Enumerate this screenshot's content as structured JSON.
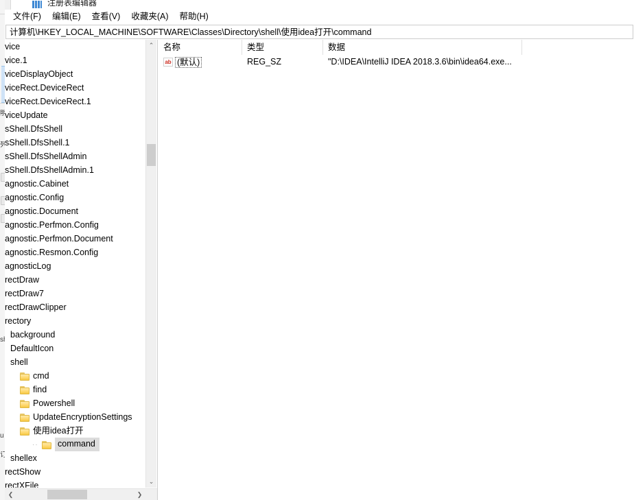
{
  "window": {
    "title": "注册表编辑器",
    "icon": "registry-editor-icon"
  },
  "menu": {
    "items": [
      {
        "label": "文件(F)"
      },
      {
        "label": "编辑(E)"
      },
      {
        "label": "查看(V)"
      },
      {
        "label": "收藏夹(A)"
      },
      {
        "label": "帮助(H)"
      }
    ]
  },
  "address": {
    "path": "计算机\\HKEY_LOCAL_MACHINE\\SOFTWARE\\Classes\\Directory\\shell\\使用idea打开\\command"
  },
  "tree": {
    "items": [
      {
        "label": "vice",
        "indent": 0,
        "icon": "none",
        "selected": false
      },
      {
        "label": "vice.1",
        "indent": 0,
        "icon": "none",
        "selected": false
      },
      {
        "label": "viceDisplayObject",
        "indent": 0,
        "icon": "none",
        "selected": false
      },
      {
        "label": "viceRect.DeviceRect",
        "indent": 0,
        "icon": "none",
        "selected": false
      },
      {
        "label": "viceRect.DeviceRect.1",
        "indent": 0,
        "icon": "none",
        "selected": false
      },
      {
        "label": "viceUpdate",
        "indent": 0,
        "icon": "none",
        "selected": false
      },
      {
        "label": "sShell.DfsShell",
        "indent": 0,
        "icon": "none",
        "selected": false
      },
      {
        "label": "sShell.DfsShell.1",
        "indent": 0,
        "icon": "none",
        "selected": false
      },
      {
        "label": "sShell.DfsShellAdmin",
        "indent": 0,
        "icon": "none",
        "selected": false
      },
      {
        "label": "sShell.DfsShellAdmin.1",
        "indent": 0,
        "icon": "none",
        "selected": false
      },
      {
        "label": "agnostic.Cabinet",
        "indent": 0,
        "icon": "none",
        "selected": false
      },
      {
        "label": "agnostic.Config",
        "indent": 0,
        "icon": "none",
        "selected": false
      },
      {
        "label": "agnostic.Document",
        "indent": 0,
        "icon": "none",
        "selected": false
      },
      {
        "label": "agnostic.Perfmon.Config",
        "indent": 0,
        "icon": "none",
        "selected": false
      },
      {
        "label": "agnostic.Perfmon.Document",
        "indent": 0,
        "icon": "none",
        "selected": false
      },
      {
        "label": "agnostic.Resmon.Config",
        "indent": 0,
        "icon": "none",
        "selected": false
      },
      {
        "label": "agnosticLog",
        "indent": 0,
        "icon": "none",
        "selected": false
      },
      {
        "label": "rectDraw",
        "indent": 0,
        "icon": "none",
        "selected": false
      },
      {
        "label": "rectDraw7",
        "indent": 0,
        "icon": "none",
        "selected": false
      },
      {
        "label": "rectDrawClipper",
        "indent": 0,
        "icon": "none",
        "selected": false
      },
      {
        "label": "rectory",
        "indent": 0,
        "icon": "none",
        "selected": false
      },
      {
        "label": "background",
        "indent": 1,
        "icon": "none",
        "selected": false
      },
      {
        "label": "DefaultIcon",
        "indent": 1,
        "icon": "none",
        "selected": false
      },
      {
        "label": "shell",
        "indent": 1,
        "icon": "none",
        "selected": false
      },
      {
        "label": "cmd",
        "indent": 2,
        "icon": "folder",
        "selected": false
      },
      {
        "label": "find",
        "indent": 2,
        "icon": "folder",
        "selected": false
      },
      {
        "label": "Powershell",
        "indent": 2,
        "icon": "folder",
        "selected": false
      },
      {
        "label": "UpdateEncryptionSettings",
        "indent": 2,
        "icon": "folder",
        "selected": false
      },
      {
        "label": "使用idea打开",
        "indent": 2,
        "icon": "folder",
        "selected": false
      },
      {
        "label": "command",
        "indent": 3,
        "icon": "folder",
        "selected": true
      },
      {
        "label": "shellex",
        "indent": 1,
        "icon": "none",
        "selected": false
      },
      {
        "label": "rectShow",
        "indent": 0,
        "icon": "none",
        "selected": false
      },
      {
        "label": "rectXFile",
        "indent": 0,
        "icon": "none",
        "selected": false
      }
    ]
  },
  "values": {
    "columns": [
      {
        "label": "名称"
      },
      {
        "label": "类型"
      },
      {
        "label": "数据"
      }
    ],
    "rows": [
      {
        "name": "(默认)",
        "type": "REG_SZ",
        "data": "\"D:\\IDEA\\IntelliJ IDEA 2018.3.6\\bin\\idea64.exe...",
        "icon": "ab-string-icon",
        "focused": true
      }
    ]
  },
  "scrollbars": {
    "tree_vertical": {
      "up_arrow": "⌃",
      "down_arrow": "⌄"
    },
    "tree_horizontal": {
      "left_arrow": "❮",
      "right_arrow": "❯"
    }
  },
  "colors": {
    "selection": "#dcdcdc",
    "folder": "#ffd971",
    "string_icon": "#cc2a1e",
    "scrollbar_thumb": "#cdcdcd",
    "border": "#cccccc"
  }
}
